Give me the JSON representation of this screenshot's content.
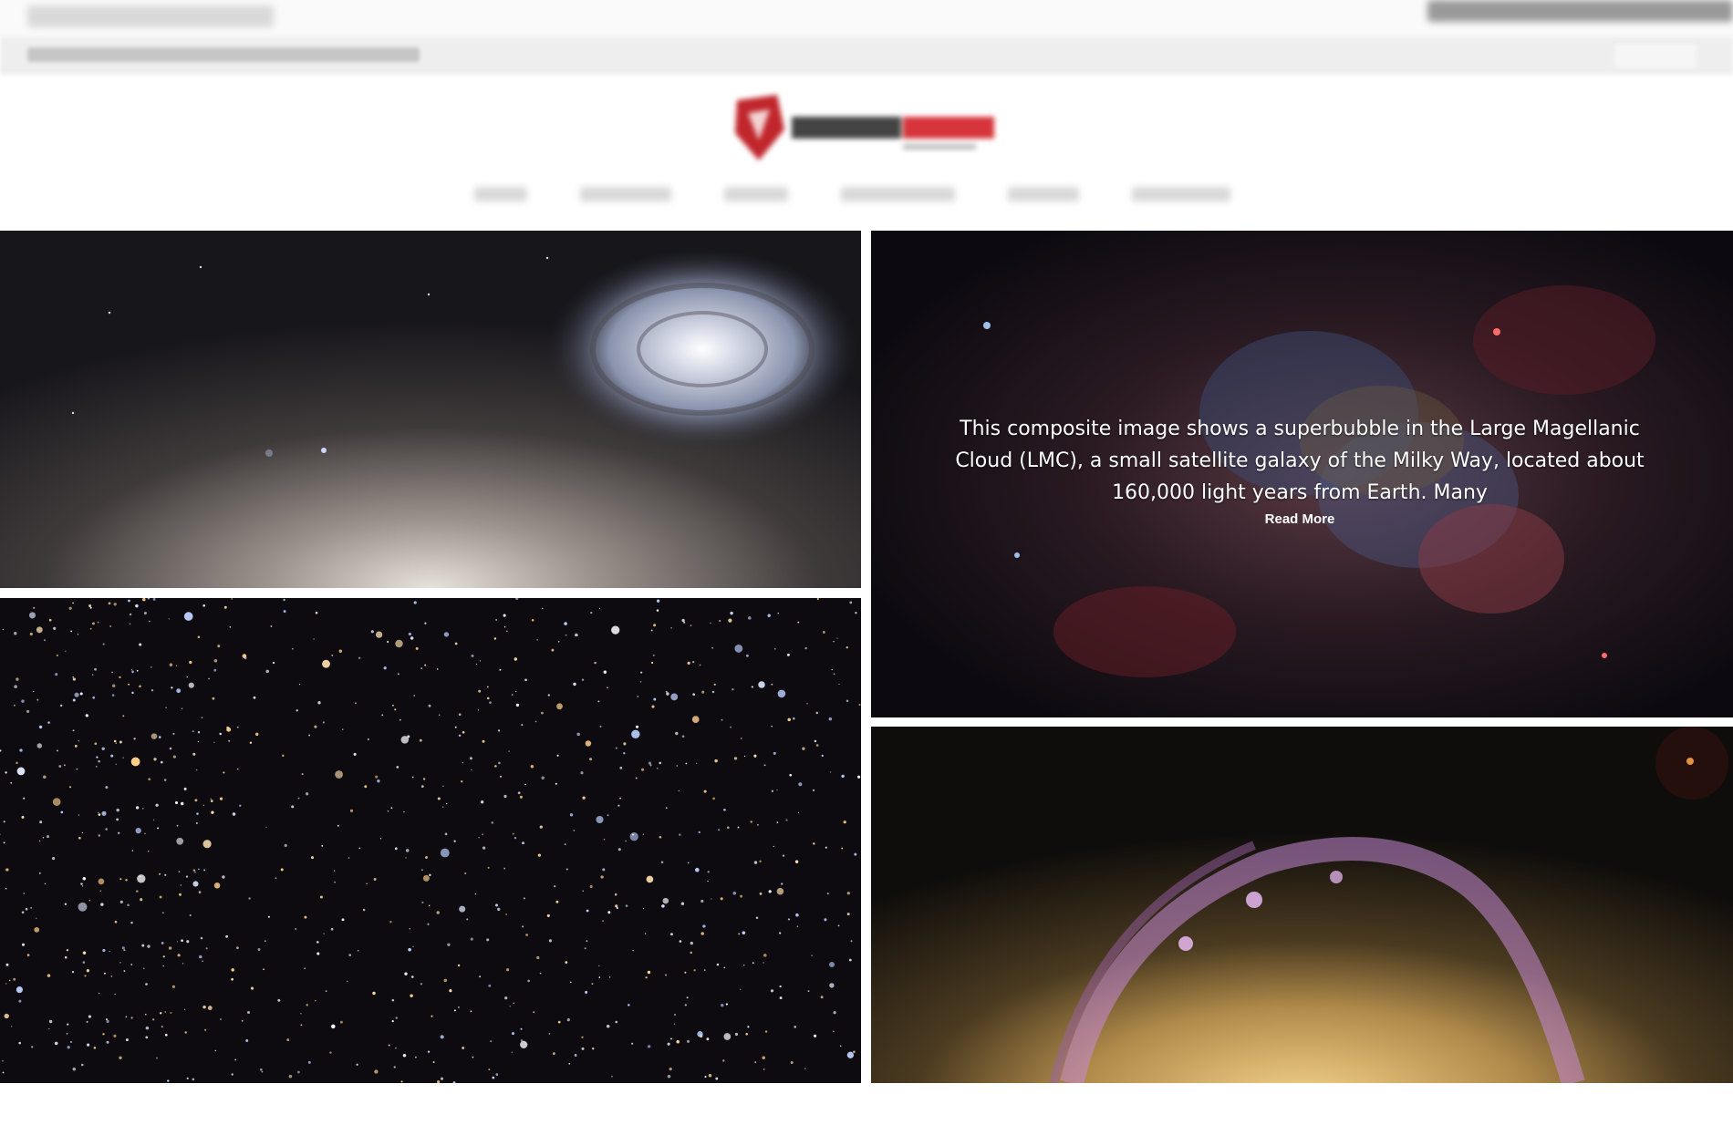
{
  "header": {
    "site_logo": "site-logo",
    "nav_items": [
      "",
      "",
      "",
      "",
      "",
      ""
    ]
  },
  "gallery": {
    "tiles": [
      {
        "id": "spiral-galaxy-tile"
      },
      {
        "id": "superbubble-tile",
        "caption": "This composite image shows a superbubble in the Large Magellanic Cloud (LMC), a small satellite galaxy of the Milky Way, located about 160,000 light years from Earth. Many",
        "read_more": "Read More"
      },
      {
        "id": "star-cluster-tile"
      },
      {
        "id": "barred-spiral-tile"
      }
    ]
  },
  "colors": {
    "logo_red": "#c0262c",
    "space_dark": "#0c0a10"
  }
}
